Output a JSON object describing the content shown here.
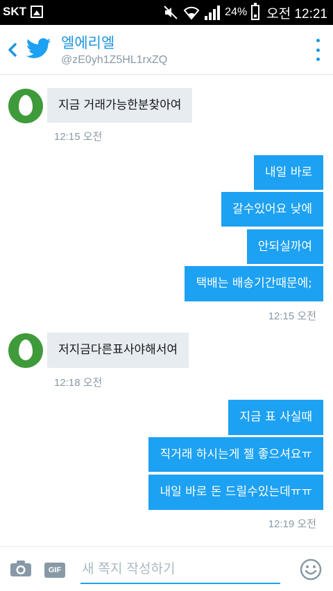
{
  "status_bar": {
    "carrier": "SKT",
    "battery_percent": "24%",
    "time": "오전 12:21"
  },
  "header": {
    "name": "엘에리엘",
    "handle": "@zE0yh1Z5HL1rxZQ",
    "accent_color": "#1b95e0"
  },
  "messages": {
    "group1": {
      "text": "지금 거래가능한분찾아여",
      "timestamp": "12:15 오전"
    },
    "group2": {
      "items": [
        "내일 바로",
        "갈수있어요 낮에",
        "안되실까여",
        "택배는 배송기간때문에;"
      ],
      "timestamp": "12:15 오전"
    },
    "group3": {
      "text": "저지금다른표사야해서여",
      "timestamp": "12:18 오전"
    },
    "group4": {
      "items": [
        "지금 표 사실때",
        "직거래 하시는게 젤 좋으셔요ㅠ",
        "내일 바로 돈 드릴수있는데ㅠㅠ"
      ],
      "timestamp": "12:19 오전"
    }
  },
  "composer": {
    "placeholder": "새 쪽지 작성하기",
    "gif_label": "GIF"
  },
  "colors": {
    "outgoing_bubble": "#1da1f2",
    "incoming_bubble": "#e6ecf0",
    "avatar": "#3f9a3a"
  }
}
